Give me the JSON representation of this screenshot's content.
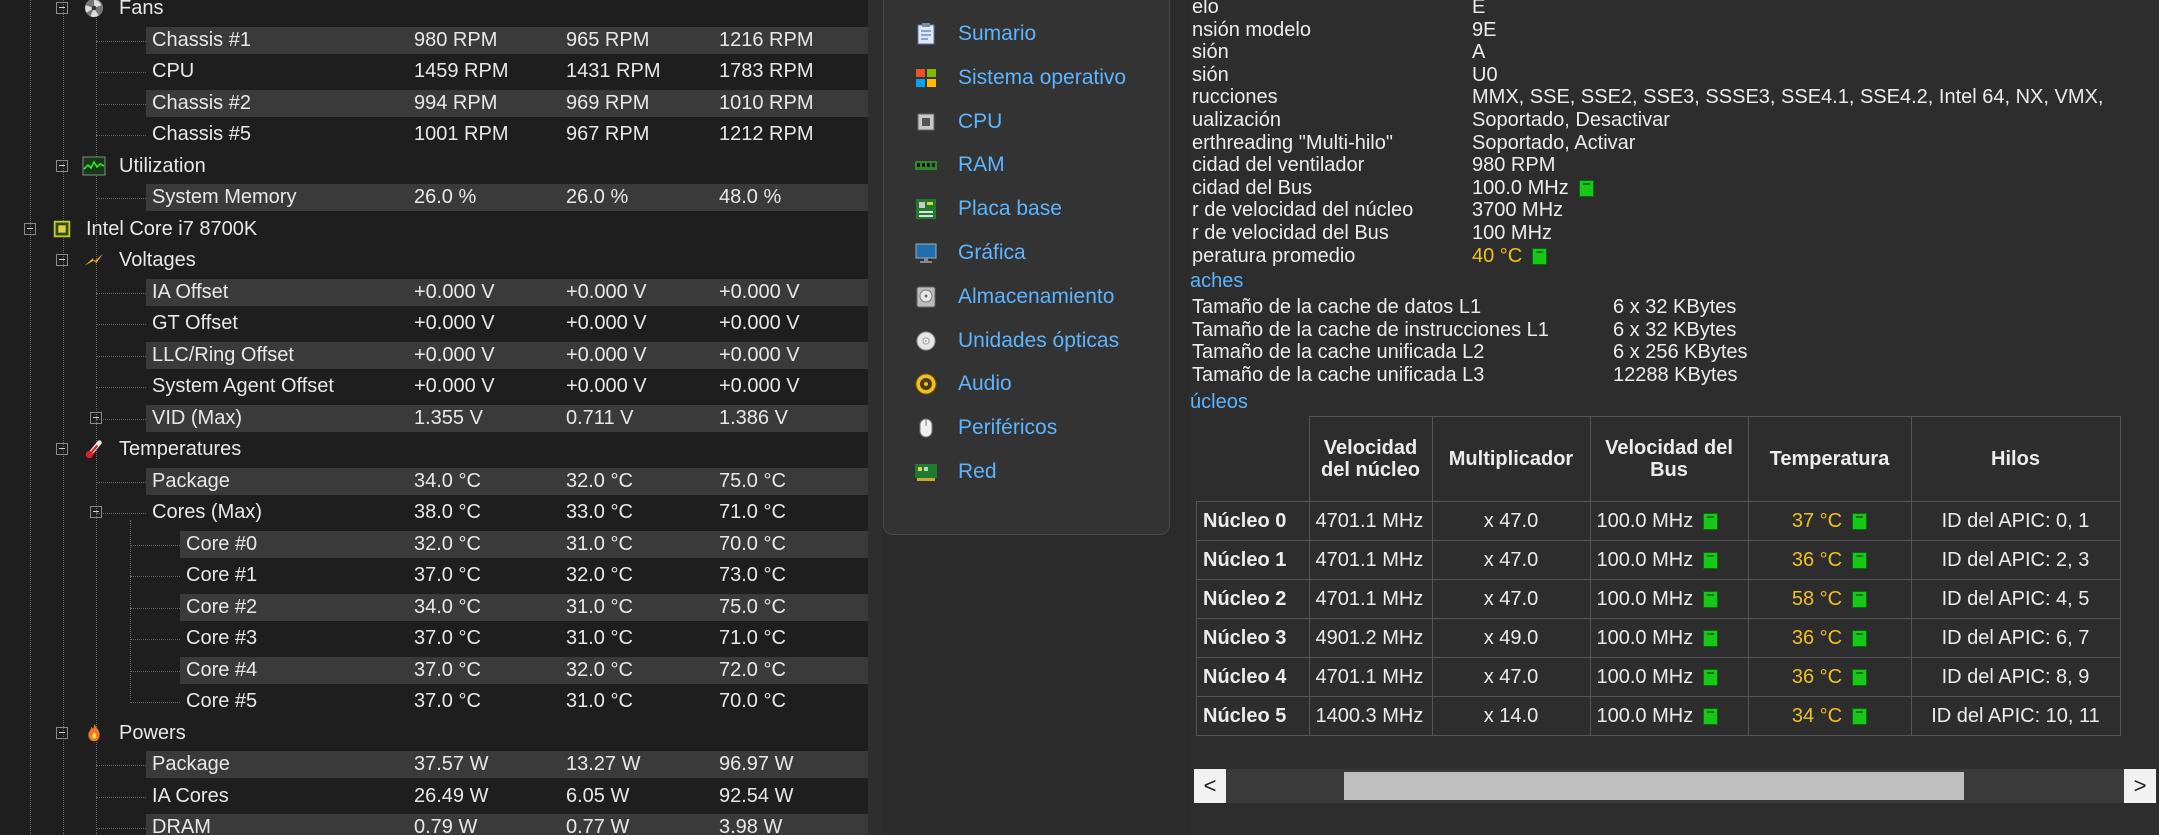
{
  "sensor_tree": {
    "rows": [
      {
        "id": "fans",
        "label": "Fans",
        "icon": "fan-icon",
        "toggle": true
      },
      {
        "id": "chassis1",
        "label": "Chassis #1",
        "values": [
          "980 RPM",
          "965 RPM",
          "1216 RPM"
        ]
      },
      {
        "id": "cpu-fan",
        "label": "CPU",
        "values": [
          "1459 RPM",
          "1431 RPM",
          "1783 RPM"
        ]
      },
      {
        "id": "chassis2",
        "label": "Chassis #2",
        "values": [
          "994 RPM",
          "969 RPM",
          "1010 RPM"
        ]
      },
      {
        "id": "chassis5",
        "label": "Chassis #5",
        "values": [
          "1001 RPM",
          "967 RPM",
          "1212 RPM"
        ]
      },
      {
        "id": "utilization",
        "label": "Utilization",
        "icon": "utilization-icon",
        "toggle": true
      },
      {
        "id": "system-memory",
        "label": "System Memory",
        "values": [
          "26.0 %",
          "26.0 %",
          "48.0 %"
        ]
      },
      {
        "id": "intel-cpu",
        "label": "Intel Core i7 8700K",
        "icon": "cpu-chip-icon",
        "toggle": true
      },
      {
        "id": "voltages",
        "label": "Voltages",
        "icon": "voltage-icon",
        "toggle": true
      },
      {
        "id": "ia-offset",
        "label": "IA Offset",
        "values": [
          "+0.000 V",
          "+0.000 V",
          "+0.000 V"
        ]
      },
      {
        "id": "gt-offset",
        "label": "GT Offset",
        "values": [
          "+0.000 V",
          "+0.000 V",
          "+0.000 V"
        ]
      },
      {
        "id": "llc-ring-offset",
        "label": "LLC/Ring Offset",
        "values": [
          "+0.000 V",
          "+0.000 V",
          "+0.000 V"
        ]
      },
      {
        "id": "system-agent-offset",
        "label": "System Agent Offset",
        "values": [
          "+0.000 V",
          "+0.000 V",
          "+0.000 V"
        ]
      },
      {
        "id": "vid-max",
        "label": "VID (Max)",
        "values": [
          "1.355 V",
          "0.711 V",
          "1.386 V"
        ],
        "toggle": true
      },
      {
        "id": "temperatures",
        "label": "Temperatures",
        "icon": "thermometer-icon",
        "toggle": true
      },
      {
        "id": "package-temp",
        "label": "Package",
        "values": [
          "34.0 °C",
          "32.0 °C",
          "75.0 °C"
        ]
      },
      {
        "id": "cores-max",
        "label": "Cores (Max)",
        "values": [
          "38.0 °C",
          "33.0 °C",
          "71.0 °C"
        ],
        "toggle": true
      },
      {
        "id": "core0",
        "label": "Core #0",
        "values": [
          "32.0 °C",
          "31.0 °C",
          "70.0 °C"
        ]
      },
      {
        "id": "core1",
        "label": "Core #1",
        "values": [
          "37.0 °C",
          "32.0 °C",
          "73.0 °C"
        ]
      },
      {
        "id": "core2",
        "label": "Core #2",
        "values": [
          "34.0 °C",
          "31.0 °C",
          "75.0 °C"
        ]
      },
      {
        "id": "core3",
        "label": "Core #3",
        "values": [
          "37.0 °C",
          "31.0 °C",
          "71.0 °C"
        ]
      },
      {
        "id": "core4",
        "label": "Core #4",
        "values": [
          "37.0 °C",
          "32.0 °C",
          "72.0 °C"
        ]
      },
      {
        "id": "core5",
        "label": "Core #5",
        "values": [
          "37.0 °C",
          "31.0 °C",
          "70.0 °C"
        ]
      },
      {
        "id": "powers",
        "label": "Powers",
        "icon": "flame-icon",
        "toggle": true
      },
      {
        "id": "package-power",
        "label": "Package",
        "values": [
          "37.57 W",
          "13.27 W",
          "96.97 W"
        ]
      },
      {
        "id": "ia-cores",
        "label": "IA Cores",
        "values": [
          "26.49 W",
          "6.05 W",
          "92.54 W"
        ]
      },
      {
        "id": "dram",
        "label": "DRAM",
        "values": [
          "0.79 W",
          "0.77 W",
          "3.98 W"
        ]
      }
    ]
  },
  "nav": {
    "items": [
      {
        "label": "Sumario",
        "icon": "summary-icon"
      },
      {
        "label": "Sistema operativo",
        "icon": "windows-icon"
      },
      {
        "label": "CPU",
        "icon": "cpu-icon"
      },
      {
        "label": "RAM",
        "icon": "ram-icon"
      },
      {
        "label": "Placa base",
        "icon": "motherboard-icon"
      },
      {
        "label": "Gráfica",
        "icon": "monitor-icon"
      },
      {
        "label": "Almacenamiento",
        "icon": "hard-drive-icon"
      },
      {
        "label": "Unidades ópticas",
        "icon": "optical-disc-icon"
      },
      {
        "label": "Audio",
        "icon": "speaker-icon"
      },
      {
        "label": "Periféricos",
        "icon": "mouse-icon"
      },
      {
        "label": "Red",
        "icon": "network-icon"
      }
    ]
  },
  "details": {
    "props": [
      {
        "label": "elo",
        "value": "E"
      },
      {
        "label": "nsión modelo",
        "value": "9E"
      },
      {
        "label": "sión",
        "value": "A"
      },
      {
        "label": "sión",
        "value": "U0"
      },
      {
        "label": "rucciones",
        "value": "MMX, SSE, SSE2, SSE3, SSSE3, SSE4.1, SSE4.2, Intel 64, NX, VMX,"
      },
      {
        "label": "ualización",
        "value": "Soportado, Desactivar"
      },
      {
        "label": "erthreading \"Multi-hilo\"",
        "value": "Soportado, Activar"
      },
      {
        "label": "cidad del ventilador",
        "value": "980 RPM"
      },
      {
        "label": "cidad del Bus",
        "value": "100.0 MHz",
        "gauge": true
      },
      {
        "label": "r de velocidad del núcleo",
        "value": "3700 MHz"
      },
      {
        "label": "r de velocidad del Bus",
        "value": "100 MHz"
      },
      {
        "label": "peratura promedio",
        "value": "40 °C",
        "gauge": true,
        "yellow": true
      }
    ],
    "caches_title": "aches",
    "caches": [
      {
        "label": "Tamaño de la cache de datos L1",
        "value": "6 x 32 KBytes"
      },
      {
        "label": "Tamaño de la cache de instrucciones L1",
        "value": "6 x 32 KBytes"
      },
      {
        "label": "Tamaño de la cache unificada L2",
        "value": "6 x 256 KBytes"
      },
      {
        "label": "Tamaño de la cache unificada L3",
        "value": "12288 KBytes"
      }
    ],
    "cores_title": "úcleos",
    "table": {
      "headers": [
        "Velocidad del núcleo",
        "Multiplicador",
        "Velocidad del Bus",
        "Temperatura",
        "Hilos"
      ],
      "rows": [
        {
          "name": "Núcleo 0",
          "speed": "4701.1 MHz",
          "mult": "x 47.0",
          "bus": "100.0 MHz",
          "temp": "37 °C",
          "threads": "ID del APIC: 0, 1"
        },
        {
          "name": "Núcleo 1",
          "speed": "4701.1 MHz",
          "mult": "x 47.0",
          "bus": "100.0 MHz",
          "temp": "36 °C",
          "threads": "ID del APIC: 2, 3"
        },
        {
          "name": "Núcleo 2",
          "speed": "4701.1 MHz",
          "mult": "x 47.0",
          "bus": "100.0 MHz",
          "temp": "58 °C",
          "threads": "ID del APIC: 4, 5"
        },
        {
          "name": "Núcleo 3",
          "speed": "4901.2 MHz",
          "mult": "x 49.0",
          "bus": "100.0 MHz",
          "temp": "36 °C",
          "threads": "ID del APIC: 6, 7"
        },
        {
          "name": "Núcleo 4",
          "speed": "4701.1 MHz",
          "mult": "x 47.0",
          "bus": "100.0 MHz",
          "temp": "36 °C",
          "threads": "ID del APIC: 8, 9"
        },
        {
          "name": "Núcleo 5",
          "speed": "1400.3 MHz",
          "mult": "x 14.0",
          "bus": "100.0 MHz",
          "temp": "34 °C",
          "threads": "ID del APIC: 10, 11"
        }
      ]
    }
  },
  "scrollbar": {
    "left_arrow": "<",
    "right_arrow": ">"
  },
  "colors": {
    "link": "#5db4ff",
    "warm": "#f0c020",
    "ok": "#18c818"
  }
}
